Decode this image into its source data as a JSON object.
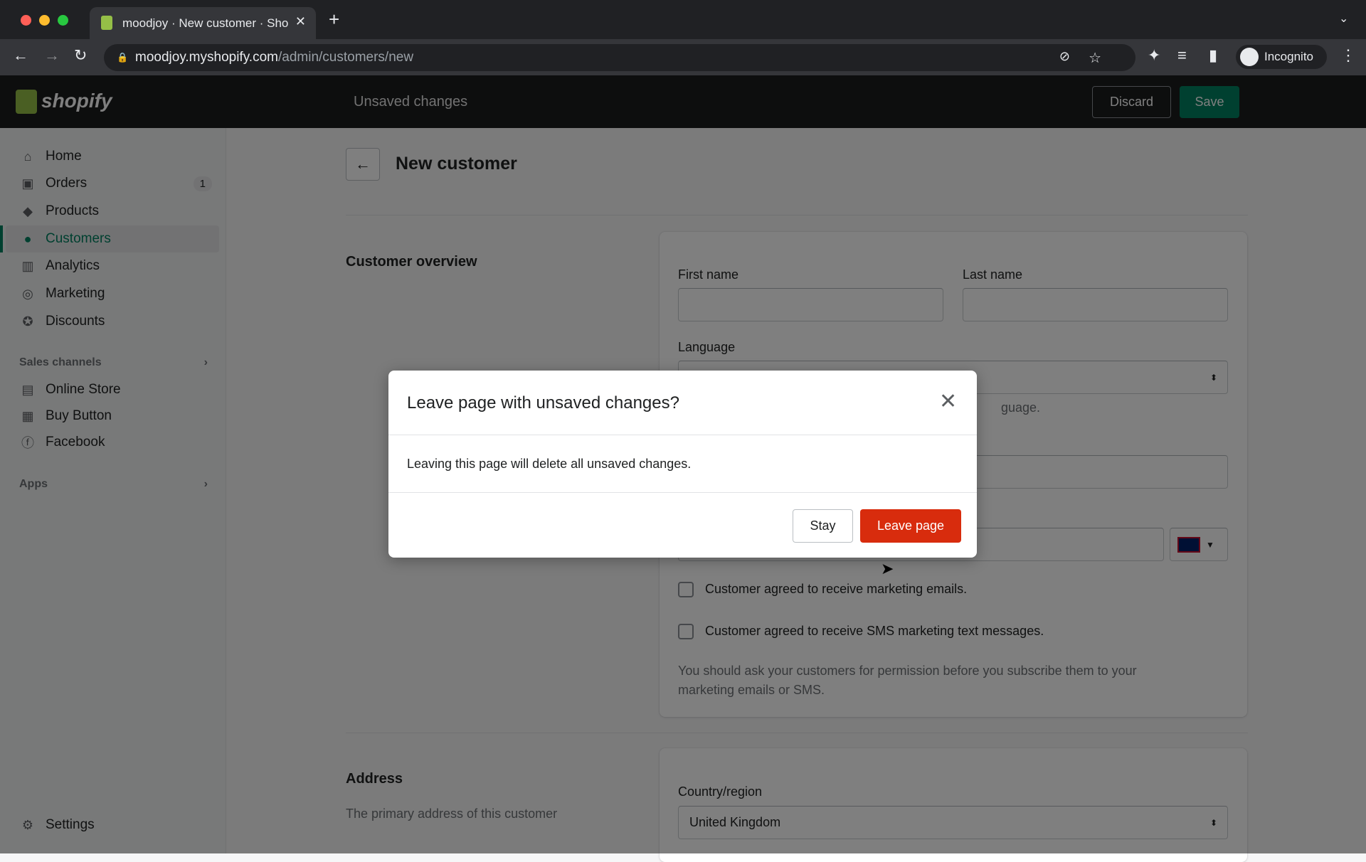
{
  "browser": {
    "tab_title": "moodjoy · New customer · Sho",
    "url_host": "moodjoy.myshopify.com",
    "url_path": "/admin/customers/new",
    "profile": "Incognito"
  },
  "topbar": {
    "logo": "shopify",
    "status": "Unsaved changes",
    "discard": "Discard",
    "save": "Save"
  },
  "sidebar": {
    "items": [
      {
        "label": "Home",
        "icon": "home-icon"
      },
      {
        "label": "Orders",
        "icon": "orders-icon",
        "badge": "1"
      },
      {
        "label": "Products",
        "icon": "tag-icon"
      },
      {
        "label": "Customers",
        "icon": "person-icon"
      },
      {
        "label": "Analytics",
        "icon": "bar-chart-icon"
      },
      {
        "label": "Marketing",
        "icon": "marketing-icon"
      },
      {
        "label": "Discounts",
        "icon": "discount-icon"
      }
    ],
    "sales_channels_label": "Sales channels",
    "channels": [
      {
        "label": "Online Store"
      },
      {
        "label": "Buy Button"
      },
      {
        "label": "Facebook"
      }
    ],
    "apps_label": "Apps",
    "settings": "Settings"
  },
  "page": {
    "title": "New customer",
    "overview": {
      "heading": "Customer overview",
      "first_name_label": "First name",
      "last_name_label": "Last name",
      "language_label": "Language",
      "language_help_visible": "guage.",
      "marketing_email": "Customer agreed to receive marketing emails.",
      "marketing_sms": "Customer agreed to receive SMS marketing text messages.",
      "notice": "You should ask your customers for permission before you subscribe them to your marketing emails or SMS."
    },
    "address": {
      "heading": "Address",
      "description": "The primary address of this customer",
      "country_label": "Country/region",
      "country_value": "United Kingdom"
    }
  },
  "modal": {
    "title": "Leave page with unsaved changes?",
    "body": "Leaving this page will delete all unsaved changes.",
    "stay": "Stay",
    "leave": "Leave page",
    "leave_color": "#d82c0d"
  },
  "colors": {
    "accent": "#008060",
    "danger": "#d82c0d"
  }
}
